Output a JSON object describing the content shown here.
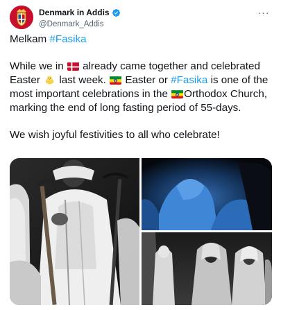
{
  "author": {
    "display_name": "Denmark in Addis",
    "handle": "@Denmark_Addis",
    "verified": true,
    "avatar_icon": "danish-royal-coat-of-arms-icon",
    "avatar_color": "#c8102e"
  },
  "menu": {
    "more_label": "···"
  },
  "tweet": {
    "line1_prefix": "Melkam ",
    "line1_hashtag": "#Fasika",
    "p2_a": "While we in ",
    "p2_b": " already came together and celebrated Easter ",
    "p2_c": " last week. ",
    "p2_d": " Easter or ",
    "p2_hashtag": "#Fasika",
    "p2_e": " is one of the most important celebrations in the ",
    "p2_f": "Orthodox Church, marking the end of long fasting period of 55-days.",
    "p3": "We wish joyful festivities to all who celebrate!"
  },
  "emoji": {
    "denmark_flag": "flag-denmark-icon",
    "chick": "hatching-chick-icon",
    "ethiopia_flag": "flag-ethiopia-icon"
  },
  "colors": {
    "link": "#1d9bf0",
    "text": "#0f1419",
    "muted": "#536471"
  },
  "media": {
    "photos": [
      {
        "name": "priest-with-staff-photo"
      },
      {
        "name": "worshippers-in-blue-light-photo"
      },
      {
        "name": "women-in-white-shawls-photo"
      }
    ]
  }
}
